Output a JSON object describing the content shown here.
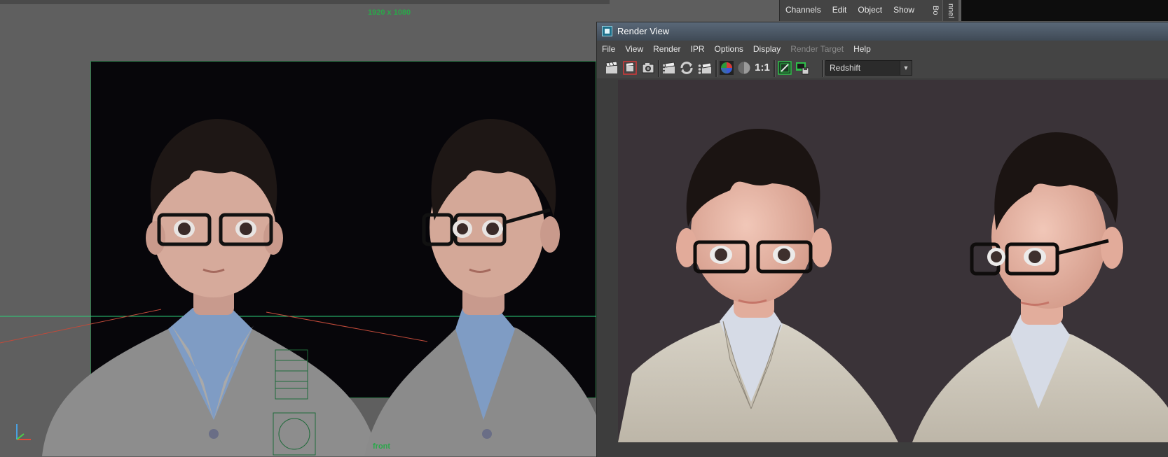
{
  "viewport": {
    "resolution_label": "1920 x 1080",
    "camera_label": "front"
  },
  "channel_box": {
    "menu": [
      "Channels",
      "Edit",
      "Object",
      "Show"
    ],
    "side_tab": "nnel Bo"
  },
  "render_view": {
    "title": "Render View",
    "menu": [
      {
        "label": "File",
        "enabled": true
      },
      {
        "label": "View",
        "enabled": true
      },
      {
        "label": "Render",
        "enabled": true
      },
      {
        "label": "IPR",
        "enabled": true
      },
      {
        "label": "Options",
        "enabled": true
      },
      {
        "label": "Display",
        "enabled": true
      },
      {
        "label": "Render Target",
        "enabled": false
      },
      {
        "label": "Help",
        "enabled": true
      }
    ],
    "toolbar": {
      "icons": [
        "clapboard-icon",
        "render-region-icon",
        "snapshot-icon",
        "ipr-render-icon",
        "refresh-icon",
        "render-sequence-icon",
        "rgb-channel-icon",
        "alpha-channel-icon",
        "real-size-icon",
        "toggle-keep-icon",
        "save-image-icon"
      ],
      "real_size_label": "1:1",
      "renderer": "Redshift"
    }
  },
  "colors": {
    "accent_green": "#2aa84a",
    "viewport_bg": "#5f5f5f",
    "panel_bg": "#444444",
    "render_bg": "#3a3338"
  }
}
